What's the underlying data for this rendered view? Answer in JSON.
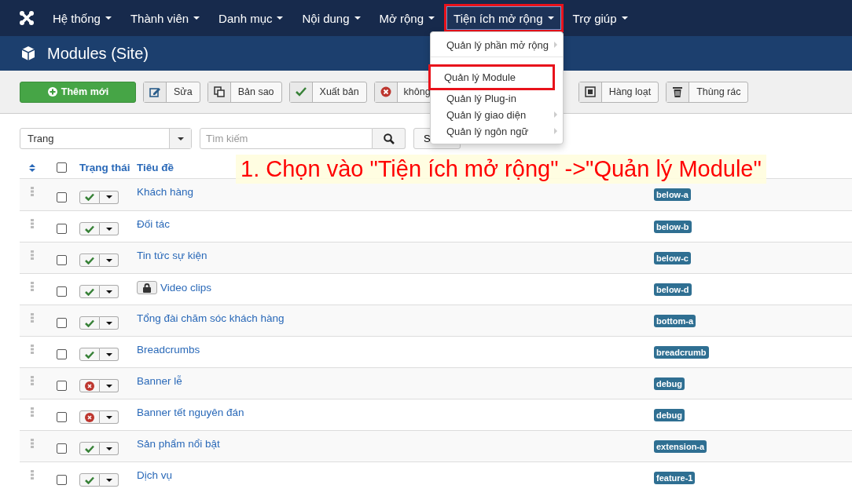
{
  "navbar": {
    "items": [
      {
        "label": "Hệ thống",
        "open": false,
        "highlighted": false
      },
      {
        "label": "Thành viên",
        "open": false,
        "highlighted": false
      },
      {
        "label": "Danh mục",
        "open": false,
        "highlighted": false
      },
      {
        "label": "Nội dung",
        "open": false,
        "highlighted": false
      },
      {
        "label": "Mở rộng",
        "open": false,
        "highlighted": false
      },
      {
        "label": "Tiện ích mở rộng",
        "open": true,
        "highlighted": true
      },
      {
        "label": "Trợ giúp",
        "open": false,
        "highlighted": false
      }
    ]
  },
  "dropdown": {
    "items": [
      {
        "label": "Quản lý phần mở rộng",
        "has_submenu": true,
        "highlighted": false,
        "divider_after": true
      },
      {
        "label": "Quản lý Module",
        "has_submenu": false,
        "highlighted": true,
        "divider_after": false
      },
      {
        "label": "Quản lý Plug-in",
        "has_submenu": false,
        "highlighted": false,
        "divider_after": false
      },
      {
        "label": "Quản lý giao diện",
        "has_submenu": true,
        "highlighted": false,
        "divider_after": false
      },
      {
        "label": "Quản lý ngôn ngữ",
        "has_submenu": true,
        "highlighted": false,
        "divider_after": false
      }
    ]
  },
  "page_title": "Modules (Site)",
  "toolbar": [
    {
      "label": "Thêm mới",
      "kind": "new"
    },
    {
      "label": "Sửa",
      "kind": "edit"
    },
    {
      "label": "Bản sao",
      "kind": "copy"
    },
    {
      "label": "Xuất bản",
      "kind": "publish"
    },
    {
      "label": "không",
      "kind": "unpublish"
    },
    {
      "label": "Hàng loạt",
      "kind": "batch"
    },
    {
      "label": "Thùng rác",
      "kind": "trash"
    }
  ],
  "filters": {
    "client": "Trang",
    "search": {
      "placeholder": "Tìm kiếm"
    },
    "tools_button": "S"
  },
  "table": {
    "select_all_checked": false,
    "columns": [
      "Trạng thái",
      "Tiêu đề"
    ],
    "rows": [
      {
        "checked": false,
        "published": true,
        "locked": false,
        "title": "Khách hàng",
        "position": "below-a"
      },
      {
        "checked": false,
        "published": true,
        "locked": false,
        "title": "Đối tác",
        "position": "below-b"
      },
      {
        "checked": false,
        "published": true,
        "locked": false,
        "title": "Tin tức sự kiện",
        "position": "below-c"
      },
      {
        "checked": false,
        "published": true,
        "locked": true,
        "title": "Video clips",
        "position": "below-d"
      },
      {
        "checked": false,
        "published": true,
        "locked": false,
        "title": "Tổng đài chăm sóc khách hàng",
        "position": "bottom-a"
      },
      {
        "checked": false,
        "published": true,
        "locked": false,
        "title": "Breadcrumbs",
        "position": "breadcrumb"
      },
      {
        "checked": false,
        "published": false,
        "locked": false,
        "title": "Banner lễ",
        "position": "debug"
      },
      {
        "checked": false,
        "published": false,
        "locked": false,
        "title": "Banner tết nguyên đán",
        "position": "debug"
      },
      {
        "checked": false,
        "published": true,
        "locked": false,
        "title": "Sản phẩm nổi bật",
        "position": "extension-a"
      },
      {
        "checked": false,
        "published": true,
        "locked": false,
        "title": "Dịch vụ",
        "position": "feature-1"
      }
    ]
  },
  "annotation": "1. Chọn vào \"Tiện ích mở rộng\" ->\"Quản lý Module\""
}
